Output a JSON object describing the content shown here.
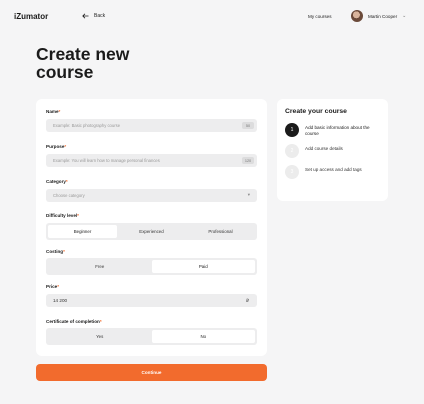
{
  "header": {
    "logo": "iZumator",
    "back_label": "Back",
    "nav_link": "My courses",
    "user_name": "Martin Cooper"
  },
  "page_title": "Create new course",
  "form": {
    "name": {
      "label": "Name",
      "placeholder": "Example: Basic photography course",
      "counter": "50"
    },
    "purpose": {
      "label": "Purpose",
      "placeholder": "Example: You will learn how to manage personal finances",
      "counter": "120"
    },
    "category": {
      "label": "Category",
      "placeholder": "Choose category"
    },
    "difficulty": {
      "label": "Difficulty level",
      "options": [
        "Beginner",
        "Experienced",
        "Professional"
      ],
      "selected": "Beginner"
    },
    "costing": {
      "label": "Costing",
      "options": [
        "Free",
        "Paid"
      ],
      "selected": "Paid"
    },
    "price": {
      "label": "Price",
      "value": "14 200",
      "currency": "₽"
    },
    "certificate": {
      "label": "Certificate of completion",
      "options": [
        "Yes",
        "No"
      ],
      "selected": "No"
    },
    "required_mark": "*"
  },
  "continue_label": "Continue",
  "steps": {
    "title": "Create your course",
    "items": [
      {
        "number": "1",
        "text": "Add basic information about the course",
        "active": true
      },
      {
        "number": "2",
        "text": "Add course details",
        "active": false
      },
      {
        "number": "3",
        "text": "Set up access and add tags",
        "active": false
      }
    ]
  },
  "colors": {
    "accent": "#f26b2d",
    "background": "#f5f5f6",
    "card": "#ffffff",
    "field": "#ededee"
  },
  "icons": {
    "back": "arrow-left-icon",
    "user_menu": "chevron-down-icon",
    "select": "chevron-down-icon"
  }
}
